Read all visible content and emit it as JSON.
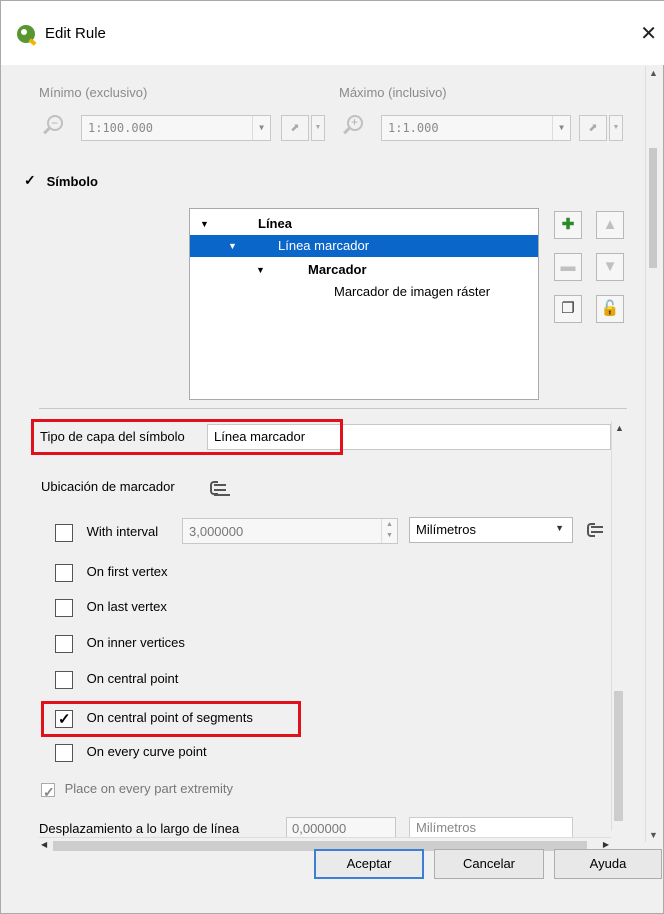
{
  "window": {
    "title": "Edit Rule",
    "close_glyph": "✕"
  },
  "scale": {
    "min_label": "Mínimo (exclusivo)",
    "max_label": "Máximo (inclusivo)",
    "min_value": "1:100.000",
    "max_value": "1:1.000"
  },
  "symbol": {
    "checkbox_label": "Símbolo",
    "checked": true,
    "tree": [
      {
        "label": "Línea",
        "level": 0,
        "bold": true,
        "expanded": true,
        "selected": false
      },
      {
        "label": "Línea marcador",
        "level": 1,
        "bold": false,
        "expanded": true,
        "selected": true
      },
      {
        "label": "Marcador",
        "level": 2,
        "bold": true,
        "expanded": true,
        "selected": false
      },
      {
        "label": "Marcador de imagen ráster",
        "level": 3,
        "bold": false,
        "expanded": false,
        "selected": false
      }
    ]
  },
  "layer_props": {
    "type_label": "Tipo de capa del símbolo",
    "type_value": "Línea marcador",
    "placement_label": "Ubicación de marcador",
    "interval": {
      "label": "With interval",
      "value": "3,000000",
      "unit": "Milímetros",
      "checked": false
    },
    "options": [
      {
        "label": "On first vertex",
        "checked": false
      },
      {
        "label": "On last vertex",
        "checked": false
      },
      {
        "label": "On inner vertices",
        "checked": false
      },
      {
        "label": "On central point",
        "checked": false
      },
      {
        "label": "On central point of segments",
        "checked": true
      },
      {
        "label": "On every curve point",
        "checked": false
      }
    ],
    "place_every_part": {
      "label": "Place on every part extremity",
      "checked": true
    },
    "offset": {
      "label": "Desplazamiento a lo largo de línea",
      "value": "0,000000",
      "unit": "Milímetros"
    }
  },
  "buttons": {
    "ok": "Aceptar",
    "cancel": "Cancelar",
    "help": "Ayuda"
  },
  "colors": {
    "selection": "#0a66c8",
    "highlight": "#e0101c",
    "primary_border": "#3c7fd4"
  }
}
